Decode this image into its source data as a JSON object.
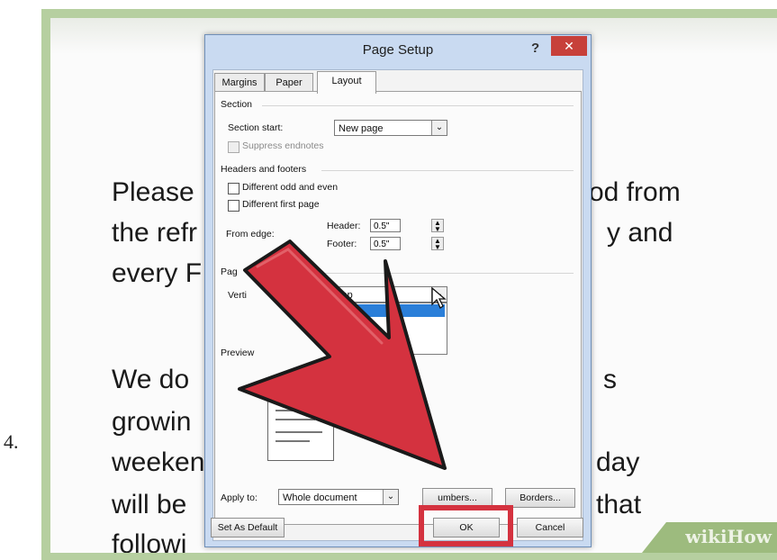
{
  "step_number": "4.",
  "document": {
    "lines_left": [
      "Please",
      "the refr",
      "every F",
      "We do",
      "growin",
      "weeken",
      "will be",
      "followi"
    ],
    "lines_right": [
      "od from",
      "y and",
      "s",
      "day",
      "that"
    ]
  },
  "watermark": "wikiHow",
  "dialog": {
    "title": "Page Setup",
    "help_label": "?",
    "close_label": "✕",
    "tabs": [
      {
        "label": "Margins",
        "active": false
      },
      {
        "label": "Paper",
        "active": false
      },
      {
        "label": "Layout",
        "active": true
      }
    ],
    "section": {
      "heading": "Section",
      "section_start_label": "Section start:",
      "section_start_value": "New page",
      "suppress_endnotes_label": "Suppress endnotes"
    },
    "headers_footers": {
      "heading": "Headers and footers",
      "different_odd_even_label": "Different odd and even",
      "different_first_page_label": "Different first page",
      "from_edge_label": "From edge:",
      "header_label": "Header:",
      "header_value": "0.5\"",
      "footer_label": "Footer:",
      "footer_value": "0.5\""
    },
    "page": {
      "heading": "Pag",
      "vertical_alignment_label": "Verti",
      "vertical_alignment_value": "Top",
      "dropdown_highlight": "Top"
    },
    "preview": {
      "heading": "Preview",
      "apply_to_label": "Apply to:",
      "apply_to_value": "Whole document",
      "line_numbers_button": "umbers...",
      "borders_button": "Borders..."
    },
    "footer": {
      "set_as_default_button": "Set As Default",
      "ok_button": "OK",
      "cancel_button": "Cancel"
    }
  },
  "colors": {
    "frame": "#b6cfa0",
    "close_button": "#c7403a",
    "arrow": "#d4323f",
    "highlight": "#d4323f",
    "selection": "#2b7fd9"
  },
  "icons": [
    "close-icon",
    "help-icon",
    "dropdown-arrow-icon",
    "spin-up-icon",
    "spin-down-icon",
    "mouse-pointer-icon",
    "red-arrow-icon"
  ]
}
